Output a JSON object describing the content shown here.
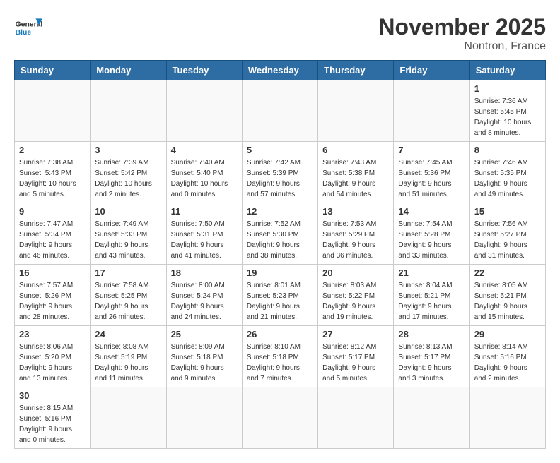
{
  "header": {
    "logo_general": "General",
    "logo_blue": "Blue",
    "month": "November 2025",
    "location": "Nontron, France"
  },
  "weekdays": [
    "Sunday",
    "Monday",
    "Tuesday",
    "Wednesday",
    "Thursday",
    "Friday",
    "Saturday"
  ],
  "days": [
    {
      "num": "",
      "info": ""
    },
    {
      "num": "",
      "info": ""
    },
    {
      "num": "",
      "info": ""
    },
    {
      "num": "",
      "info": ""
    },
    {
      "num": "",
      "info": ""
    },
    {
      "num": "",
      "info": ""
    },
    {
      "num": "1",
      "sunrise": "Sunrise: 7:36 AM",
      "sunset": "Sunset: 5:45 PM",
      "daylight": "Daylight: 10 hours and 8 minutes."
    },
    {
      "num": "2",
      "sunrise": "Sunrise: 7:38 AM",
      "sunset": "Sunset: 5:43 PM",
      "daylight": "Daylight: 10 hours and 5 minutes."
    },
    {
      "num": "3",
      "sunrise": "Sunrise: 7:39 AM",
      "sunset": "Sunset: 5:42 PM",
      "daylight": "Daylight: 10 hours and 2 minutes."
    },
    {
      "num": "4",
      "sunrise": "Sunrise: 7:40 AM",
      "sunset": "Sunset: 5:40 PM",
      "daylight": "Daylight: 10 hours and 0 minutes."
    },
    {
      "num": "5",
      "sunrise": "Sunrise: 7:42 AM",
      "sunset": "Sunset: 5:39 PM",
      "daylight": "Daylight: 9 hours and 57 minutes."
    },
    {
      "num": "6",
      "sunrise": "Sunrise: 7:43 AM",
      "sunset": "Sunset: 5:38 PM",
      "daylight": "Daylight: 9 hours and 54 minutes."
    },
    {
      "num": "7",
      "sunrise": "Sunrise: 7:45 AM",
      "sunset": "Sunset: 5:36 PM",
      "daylight": "Daylight: 9 hours and 51 minutes."
    },
    {
      "num": "8",
      "sunrise": "Sunrise: 7:46 AM",
      "sunset": "Sunset: 5:35 PM",
      "daylight": "Daylight: 9 hours and 49 minutes."
    },
    {
      "num": "9",
      "sunrise": "Sunrise: 7:47 AM",
      "sunset": "Sunset: 5:34 PM",
      "daylight": "Daylight: 9 hours and 46 minutes."
    },
    {
      "num": "10",
      "sunrise": "Sunrise: 7:49 AM",
      "sunset": "Sunset: 5:33 PM",
      "daylight": "Daylight: 9 hours and 43 minutes."
    },
    {
      "num": "11",
      "sunrise": "Sunrise: 7:50 AM",
      "sunset": "Sunset: 5:31 PM",
      "daylight": "Daylight: 9 hours and 41 minutes."
    },
    {
      "num": "12",
      "sunrise": "Sunrise: 7:52 AM",
      "sunset": "Sunset: 5:30 PM",
      "daylight": "Daylight: 9 hours and 38 minutes."
    },
    {
      "num": "13",
      "sunrise": "Sunrise: 7:53 AM",
      "sunset": "Sunset: 5:29 PM",
      "daylight": "Daylight: 9 hours and 36 minutes."
    },
    {
      "num": "14",
      "sunrise": "Sunrise: 7:54 AM",
      "sunset": "Sunset: 5:28 PM",
      "daylight": "Daylight: 9 hours and 33 minutes."
    },
    {
      "num": "15",
      "sunrise": "Sunrise: 7:56 AM",
      "sunset": "Sunset: 5:27 PM",
      "daylight": "Daylight: 9 hours and 31 minutes."
    },
    {
      "num": "16",
      "sunrise": "Sunrise: 7:57 AM",
      "sunset": "Sunset: 5:26 PM",
      "daylight": "Daylight: 9 hours and 28 minutes."
    },
    {
      "num": "17",
      "sunrise": "Sunrise: 7:58 AM",
      "sunset": "Sunset: 5:25 PM",
      "daylight": "Daylight: 9 hours and 26 minutes."
    },
    {
      "num": "18",
      "sunrise": "Sunrise: 8:00 AM",
      "sunset": "Sunset: 5:24 PM",
      "daylight": "Daylight: 9 hours and 24 minutes."
    },
    {
      "num": "19",
      "sunrise": "Sunrise: 8:01 AM",
      "sunset": "Sunset: 5:23 PM",
      "daylight": "Daylight: 9 hours and 21 minutes."
    },
    {
      "num": "20",
      "sunrise": "Sunrise: 8:03 AM",
      "sunset": "Sunset: 5:22 PM",
      "daylight": "Daylight: 9 hours and 19 minutes."
    },
    {
      "num": "21",
      "sunrise": "Sunrise: 8:04 AM",
      "sunset": "Sunset: 5:21 PM",
      "daylight": "Daylight: 9 hours and 17 minutes."
    },
    {
      "num": "22",
      "sunrise": "Sunrise: 8:05 AM",
      "sunset": "Sunset: 5:21 PM",
      "daylight": "Daylight: 9 hours and 15 minutes."
    },
    {
      "num": "23",
      "sunrise": "Sunrise: 8:06 AM",
      "sunset": "Sunset: 5:20 PM",
      "daylight": "Daylight: 9 hours and 13 minutes."
    },
    {
      "num": "24",
      "sunrise": "Sunrise: 8:08 AM",
      "sunset": "Sunset: 5:19 PM",
      "daylight": "Daylight: 9 hours and 11 minutes."
    },
    {
      "num": "25",
      "sunrise": "Sunrise: 8:09 AM",
      "sunset": "Sunset: 5:18 PM",
      "daylight": "Daylight: 9 hours and 9 minutes."
    },
    {
      "num": "26",
      "sunrise": "Sunrise: 8:10 AM",
      "sunset": "Sunset: 5:18 PM",
      "daylight": "Daylight: 9 hours and 7 minutes."
    },
    {
      "num": "27",
      "sunrise": "Sunrise: 8:12 AM",
      "sunset": "Sunset: 5:17 PM",
      "daylight": "Daylight: 9 hours and 5 minutes."
    },
    {
      "num": "28",
      "sunrise": "Sunrise: 8:13 AM",
      "sunset": "Sunset: 5:17 PM",
      "daylight": "Daylight: 9 hours and 3 minutes."
    },
    {
      "num": "29",
      "sunrise": "Sunrise: 8:14 AM",
      "sunset": "Sunset: 5:16 PM",
      "daylight": "Daylight: 9 hours and 2 minutes."
    },
    {
      "num": "30",
      "sunrise": "Sunrise: 8:15 AM",
      "sunset": "Sunset: 5:16 PM",
      "daylight": "Daylight: 9 hours and 0 minutes."
    },
    {
      "num": "",
      "info": ""
    },
    {
      "num": "",
      "info": ""
    },
    {
      "num": "",
      "info": ""
    },
    {
      "num": "",
      "info": ""
    },
    {
      "num": "",
      "info": ""
    },
    {
      "num": "",
      "info": ""
    }
  ]
}
